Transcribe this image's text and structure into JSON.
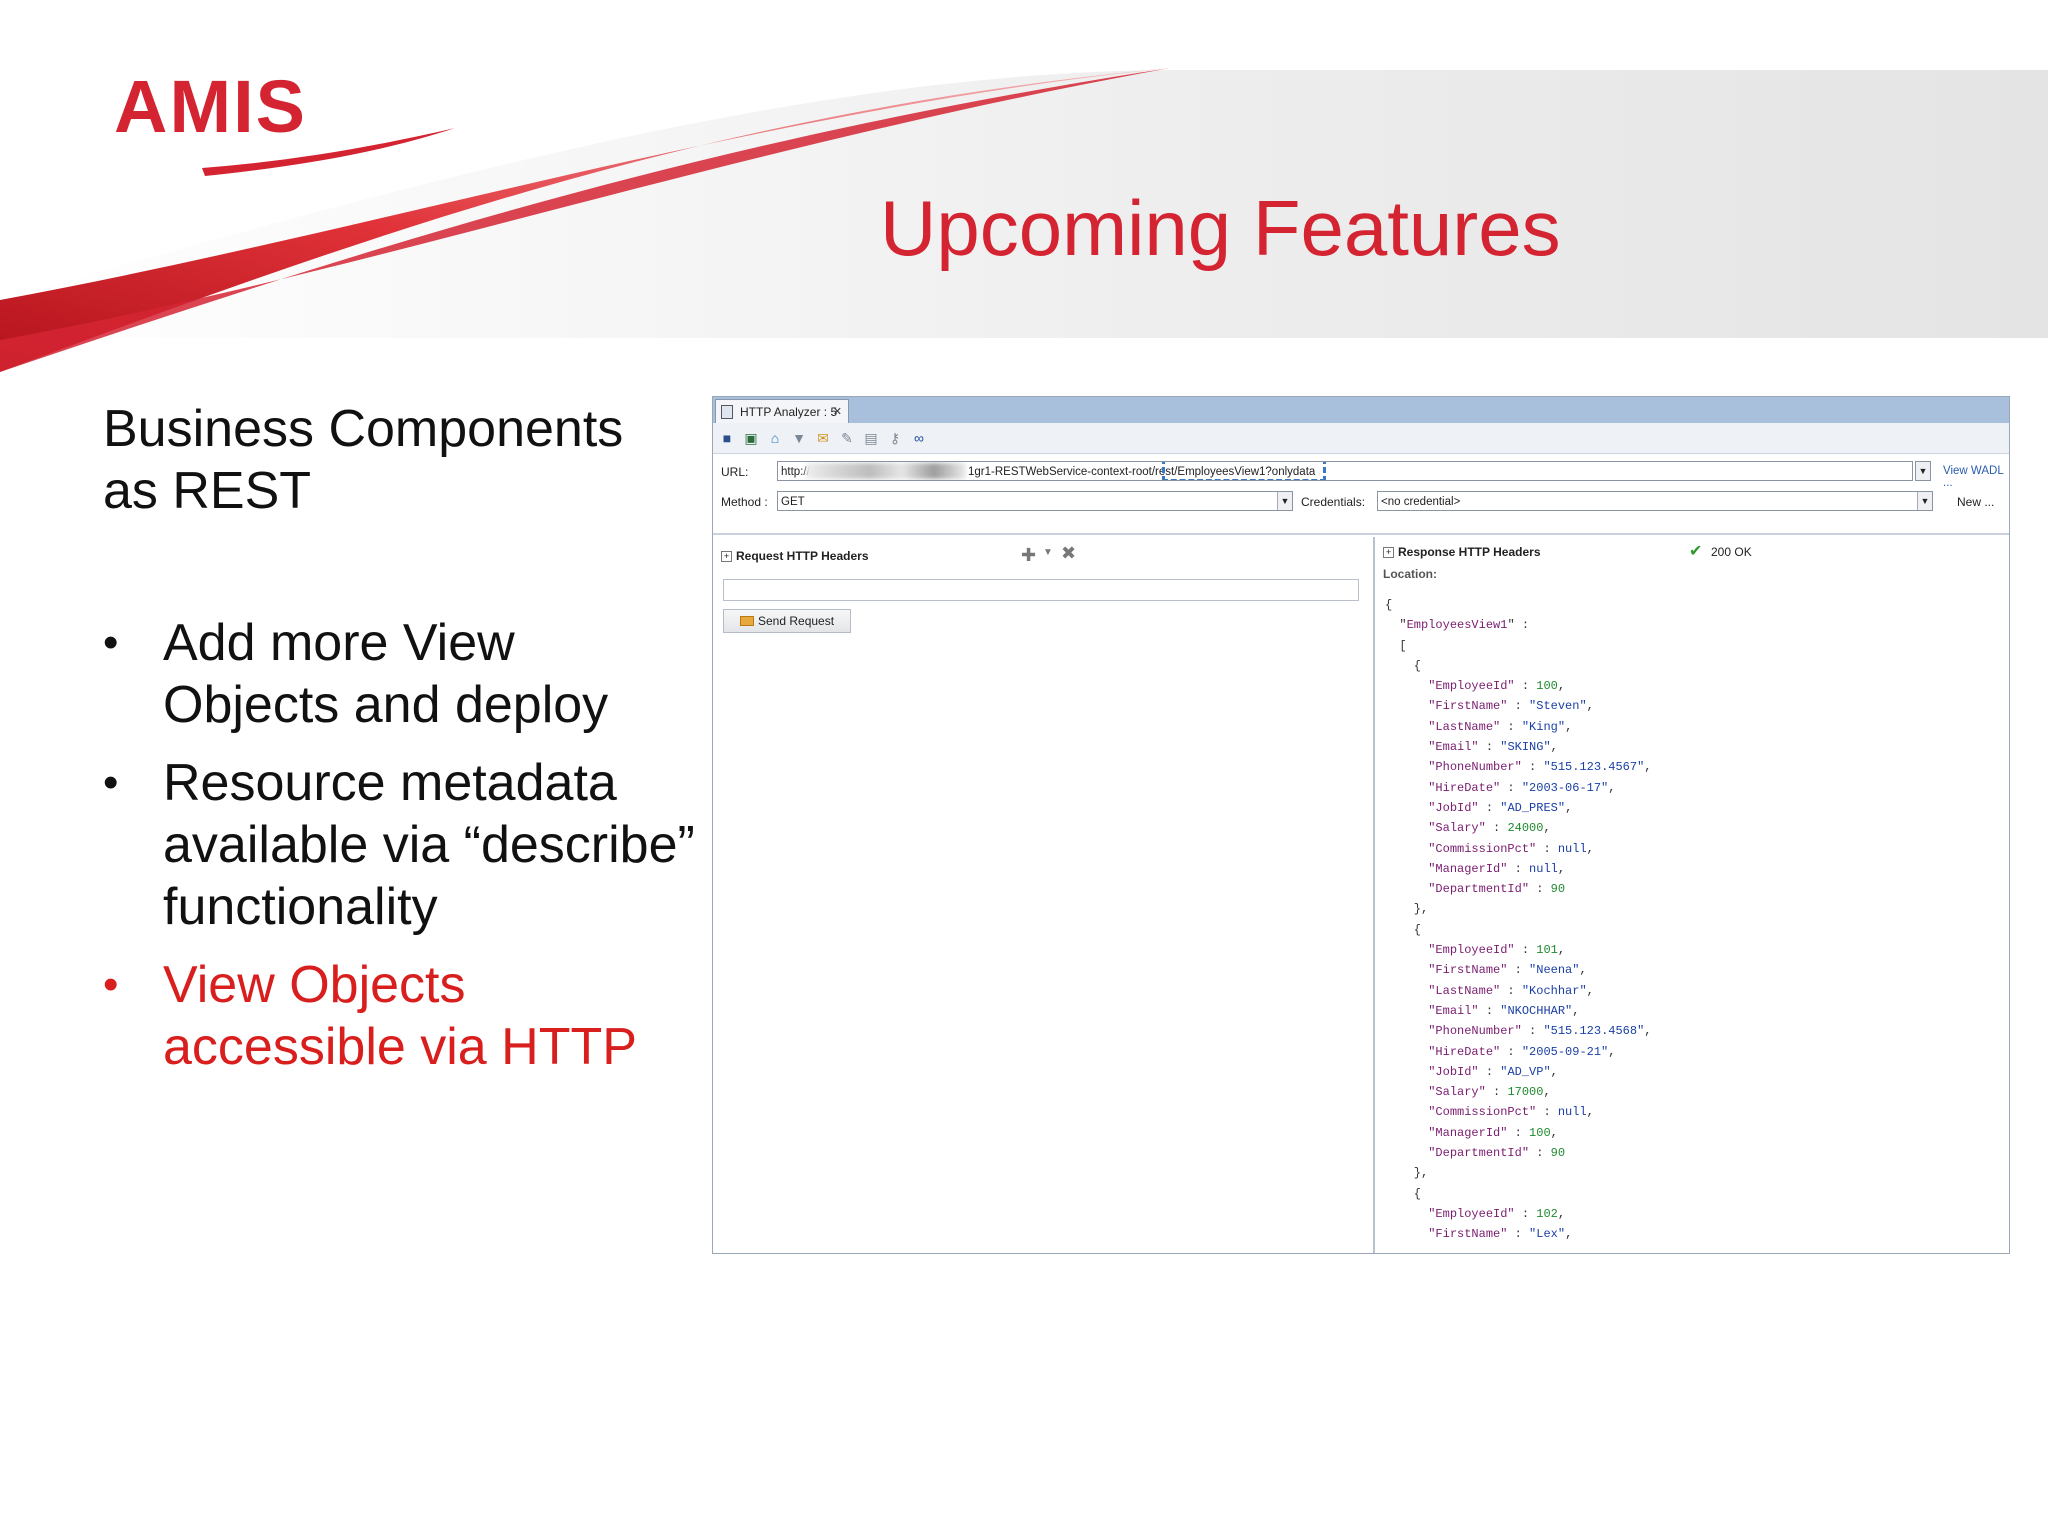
{
  "slide": {
    "logo_text": "AMIS",
    "title": "Upcoming Features",
    "subtitle_line1": "Business Components",
    "subtitle_line2": "as REST",
    "bullets": [
      {
        "text": "Add more View Objects and deploy",
        "highlight": false
      },
      {
        "text": "Resource metadata available via “describe” functionality",
        "highlight": false
      },
      {
        "text": "View Objects accessible via HTTP",
        "highlight": true
      }
    ],
    "colors": {
      "accent": "#d42432",
      "highlight": "#d91e1e",
      "text": "#111111"
    }
  },
  "analyzer": {
    "tab_label": "HTTP Analyzer : 5",
    "toolbar_icons": [
      "save-icon",
      "save-all-icon",
      "home-icon",
      "down-icon",
      "mail-icon",
      "edit-icon",
      "copy-icon",
      "key-icon",
      "binoculars-icon"
    ],
    "url_label": "URL:",
    "url_prefix": "http://",
    "url_suffix": "1gr1-RESTWebService-context-root/rest/EmployeesView1?onlydata",
    "view_wadl": "View WADL ...",
    "method_label": "Method :",
    "method_value": "GET",
    "credentials_label": "Credentials:",
    "credentials_value": "<no credential>",
    "new_button": "New ...",
    "request_headers": "Request HTTP Headers",
    "send_request": "Send Request",
    "response_headers": "Response HTTP Headers",
    "status": "200 OK",
    "location_label": "Location:",
    "response_root": "EmployeesView1",
    "employees": [
      {
        "EmployeeId": "100",
        "FirstName": "\"Steven\"",
        "LastName": "\"King\"",
        "Email": "\"SKING\"",
        "PhoneNumber": "\"515.123.4567\"",
        "HireDate": "\"2003-06-17\"",
        "JobId": "\"AD_PRES\"",
        "Salary": "24000",
        "CommissionPct": "null",
        "ManagerId": "null",
        "DepartmentId": "90"
      },
      {
        "EmployeeId": "101",
        "FirstName": "\"Neena\"",
        "LastName": "\"Kochhar\"",
        "Email": "\"NKOCHHAR\"",
        "PhoneNumber": "\"515.123.4568\"",
        "HireDate": "\"2005-09-21\"",
        "JobId": "\"AD_VP\"",
        "Salary": "17000",
        "CommissionPct": "null",
        "ManagerId": "100",
        "DepartmentId": "90"
      },
      {
        "EmployeeId": "102",
        "FirstName": "\"Lex\""
      }
    ]
  }
}
